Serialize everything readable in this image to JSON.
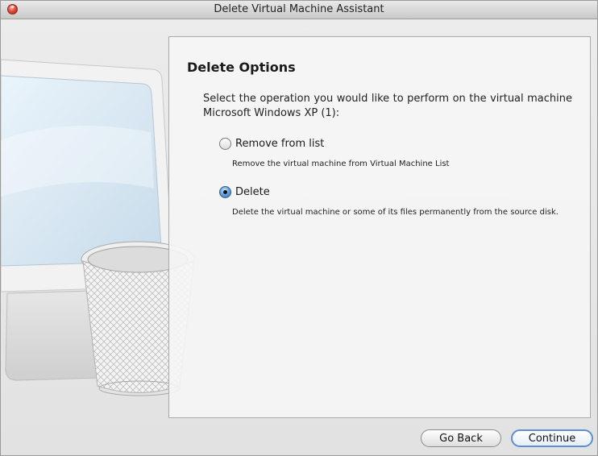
{
  "window": {
    "title": "Delete Virtual Machine Assistant"
  },
  "panel": {
    "title": "Delete Options",
    "description": "Select the operation you would like to perform on the virtual machine Microsoft Windows XP (1):",
    "options": [
      {
        "label": "Remove from list",
        "description": "Remove the virtual machine from Virtual Machine List",
        "selected": false
      },
      {
        "label": "Delete",
        "description": "Delete the virtual machine or some of its files permanently from the source disk.",
        "selected": true
      }
    ]
  },
  "buttons": {
    "back": "Go Back",
    "continue": "Continue"
  },
  "colors": {
    "close_button": "#e2473a",
    "default_button_border": "#5b8fd1",
    "radio_selected": "#2f6cb4"
  },
  "icons": {
    "illustration": "computer-monitor-with-trash-can"
  }
}
